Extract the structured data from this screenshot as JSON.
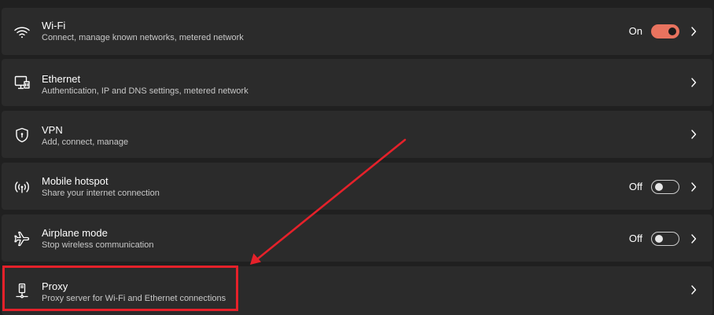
{
  "rows": [
    {
      "title": "Wi-Fi",
      "subtitle": "Connect, manage known networks, metered network",
      "icon": "wifi-icon",
      "toggle_label": "On",
      "toggle_on": true
    },
    {
      "title": "Ethernet",
      "subtitle": "Authentication, IP and DNS settings, metered network",
      "icon": "ethernet-icon"
    },
    {
      "title": "VPN",
      "subtitle": "Add, connect, manage",
      "icon": "shield-icon"
    },
    {
      "title": "Mobile hotspot",
      "subtitle": "Share your internet connection",
      "icon": "hotspot-icon",
      "toggle_label": "Off",
      "toggle_on": false
    },
    {
      "title": "Airplane mode",
      "subtitle": "Stop wireless communication",
      "icon": "airplane-icon",
      "toggle_label": "Off",
      "toggle_on": false
    },
    {
      "title": "Proxy",
      "subtitle": "Proxy server for Wi-Fi and Ethernet connections",
      "icon": "proxy-icon"
    }
  ],
  "colors": {
    "background": "#202020",
    "row": "#2b2b2b",
    "accent": "#e8735f",
    "annotation": "#e5212a"
  }
}
